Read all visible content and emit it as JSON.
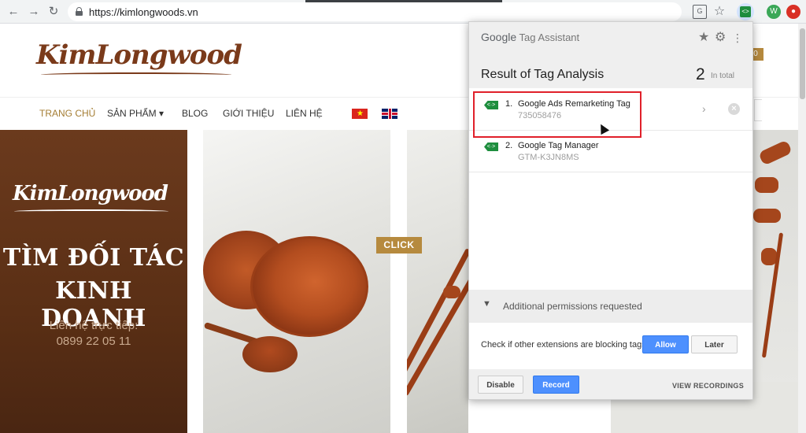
{
  "browser": {
    "url": "https://kimlongwoods.vn",
    "back": "←",
    "forward": "→",
    "reload": "↻",
    "star": "☆",
    "ext_w": "W",
    "ext_r": "●"
  },
  "site": {
    "logo": "KimLongwood",
    "cart_badge": "0",
    "nav": [
      "TRANG CHỦ",
      "SẢN PHẨM",
      "BLOG",
      "GIỚI THIỆU",
      "LIÊN HỆ"
    ],
    "nav_dropdown": "▾",
    "promo": {
      "logo": "KimLongwood",
      "title_line1": "TÌM ĐỐI TÁC",
      "title_line2": "KINH DOANH",
      "contact_label": "Liên hệ trực tiếp:",
      "phone": "0899 22 05 11"
    },
    "click_badge": "CLICK"
  },
  "tag_assistant": {
    "brand_google": "Google",
    "brand_name": "Tag Assistant",
    "title": "Result of Tag Analysis",
    "count": "2",
    "count_label": "In total",
    "tags": [
      {
        "num": "1.",
        "name": "Google Ads Remarketing Tag",
        "id": "735058476",
        "icon_text": "<·>"
      },
      {
        "num": "2.",
        "name": "Google Tag Manager",
        "id": "GTM-K3JN8MS",
        "icon_text": "<·>"
      }
    ],
    "permissions": "Additional permissions requested",
    "check_text": "Check if other extensions are blocking tags",
    "allow": "Allow",
    "later": "Later",
    "disable": "Disable",
    "record": "Record",
    "view_recordings": "VIEW RECORDINGS"
  },
  "colors": {
    "brand_brown": "#7a3a1a",
    "accent_gold": "#b68a3e",
    "google_blue": "#4d90fe",
    "tag_green": "#1e8e3e",
    "highlight_red": "#e0202a"
  },
  "icons": [
    "back-icon",
    "forward-icon",
    "reload-icon",
    "lock-icon",
    "translate-icon",
    "star-icon",
    "tag-assistant-icon",
    "gear-icon",
    "more-icon",
    "chevron-right-icon",
    "close-icon",
    "chevron-down-icon"
  ]
}
